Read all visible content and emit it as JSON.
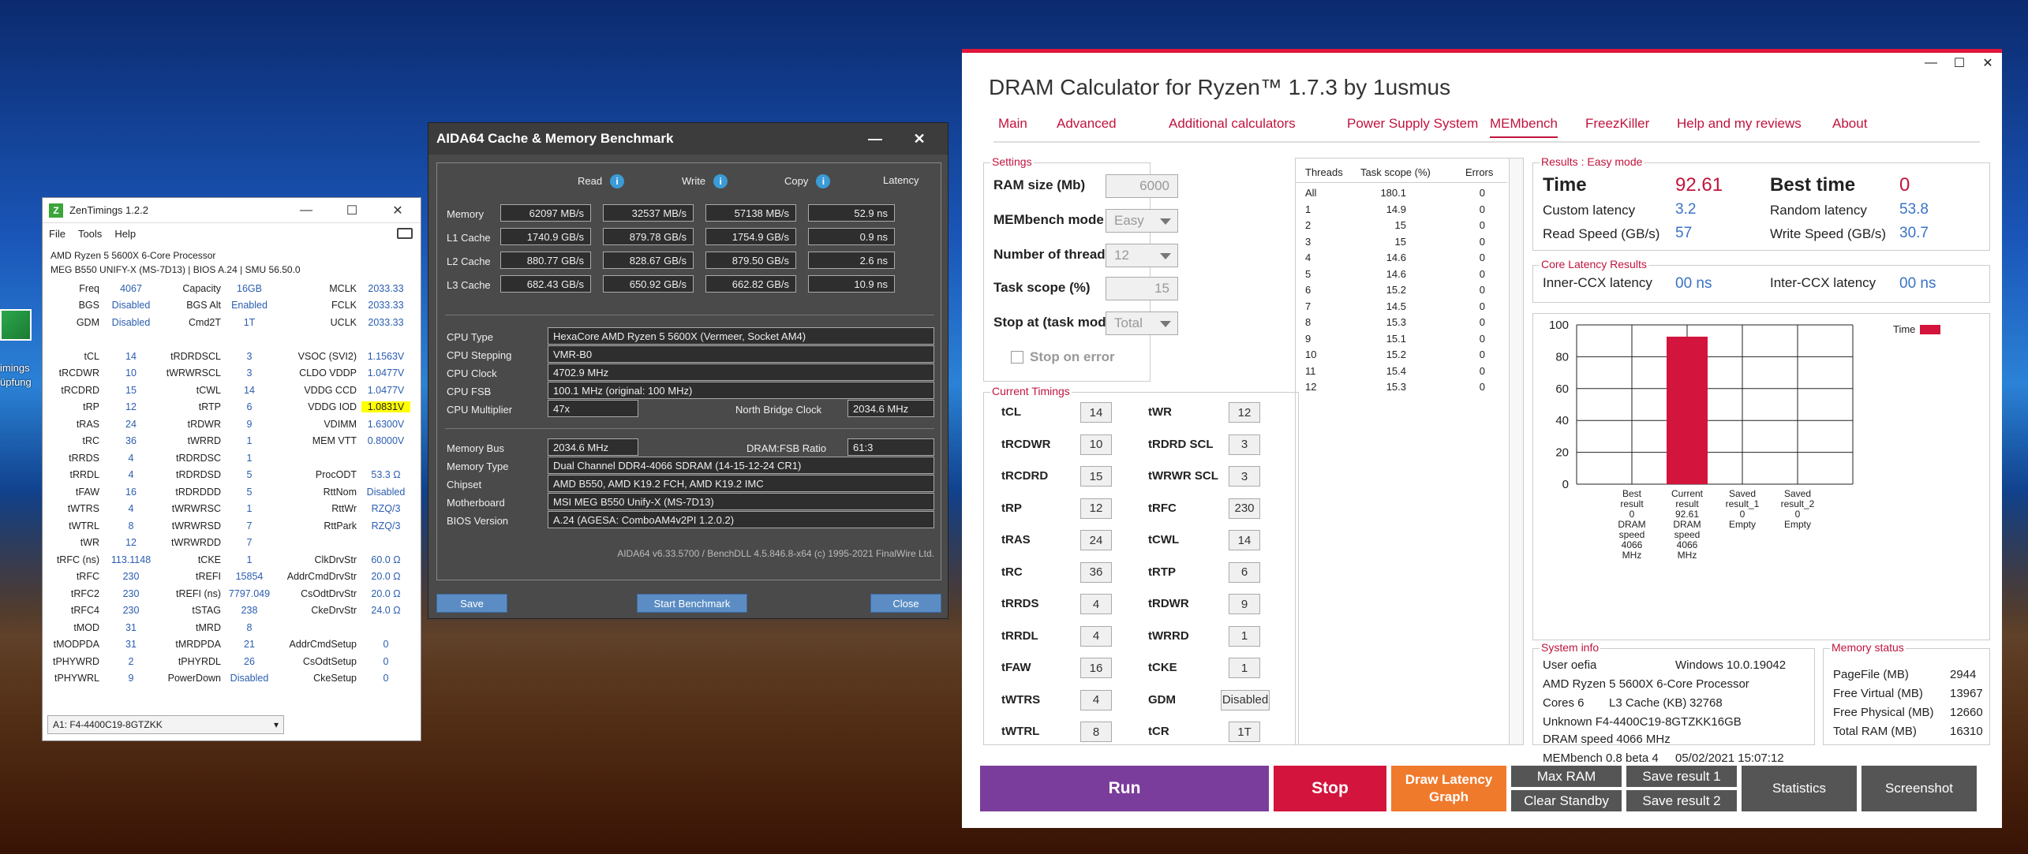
{
  "desktop": {
    "icon_label_1": "imings",
    "icon_label_2": "üpfung"
  },
  "zen": {
    "title": "ZenTimings 1.2.2",
    "menu": [
      "File",
      "Tools",
      "Help"
    ],
    "cpu": "AMD Ryzen 5 5600X 6-Core Processor",
    "board": "MEG B550 UNIFY-X (MS-7D13) | BIOS A.24 | SMU 56.50.0",
    "rows": [
      [
        "Freq",
        "4067",
        "Capacity",
        "16GB",
        "MCLK",
        "2033.33"
      ],
      [
        "BGS",
        "Disabled",
        "BGS Alt",
        "Enabled",
        "FCLK",
        "2033.33"
      ],
      [
        "GDM",
        "Disabled",
        "Cmd2T",
        "1T",
        "UCLK",
        "2033.33"
      ],
      [
        "",
        "",
        "",
        "",
        "",
        ""
      ],
      [
        "tCL",
        "14",
        "tRDRDSCL",
        "3",
        "VSOC (SVI2)",
        "1.1563V"
      ],
      [
        "tRCDWR",
        "10",
        "tWRWRSCL",
        "3",
        "CLDO VDDP",
        "1.0477V"
      ],
      [
        "tRCDRD",
        "15",
        "tCWL",
        "14",
        "VDDG CCD",
        "1.0477V"
      ],
      [
        "tRP",
        "12",
        "tRTP",
        "6",
        "VDDG IOD",
        "1.0831V"
      ],
      [
        "tRAS",
        "24",
        "tRDWR",
        "9",
        "VDIMM",
        "1.6300V"
      ],
      [
        "tRC",
        "36",
        "tWRRD",
        "1",
        "MEM VTT",
        "0.8000V"
      ],
      [
        "tRRDS",
        "4",
        "tRDRDSC",
        "1",
        "",
        ""
      ],
      [
        "tRRDL",
        "4",
        "tRDRDSD",
        "5",
        "ProcODT",
        "53.3 Ω"
      ],
      [
        "tFAW",
        "16",
        "tRDRDDD",
        "5",
        "RttNom",
        "Disabled"
      ],
      [
        "tWTRS",
        "4",
        "tWRWRSC",
        "1",
        "RttWr",
        "RZQ/3"
      ],
      [
        "tWTRL",
        "8",
        "tWRWRSD",
        "7",
        "RttPark",
        "RZQ/3"
      ],
      [
        "tWR",
        "12",
        "tWRWRDD",
        "7",
        "",
        ""
      ],
      [
        "tRFC (ns)",
        "113.1148",
        "tCKE",
        "1",
        "ClkDrvStr",
        "60.0 Ω"
      ],
      [
        "tRFC",
        "230",
        "tREFI",
        "15854",
        "AddrCmdDrvStr",
        "20.0 Ω"
      ],
      [
        "tRFC2",
        "230",
        "tREFI (ns)",
        "7797.049",
        "CsOdtDrvStr",
        "20.0 Ω"
      ],
      [
        "tRFC4",
        "230",
        "tSTAG",
        "238",
        "CkeDrvStr",
        "24.0 Ω"
      ],
      [
        "tMOD",
        "31",
        "tMRD",
        "8",
        "",
        ""
      ],
      [
        "tMODPDA",
        "31",
        "tMRDPDA",
        "21",
        "AddrCmdSetup",
        "0"
      ],
      [
        "tPHYWRD",
        "2",
        "tPHYRDL",
        "26",
        "CsOdtSetup",
        "0"
      ],
      [
        "tPHYWRL",
        "9",
        "PowerDown",
        "Disabled",
        "CkeSetup",
        "0"
      ]
    ],
    "module": "A1: F4-4400C19-8GTZKK"
  },
  "aida": {
    "title": "AIDA64 Cache & Memory Benchmark",
    "headers": [
      "Read",
      "Write",
      "Copy",
      "Latency"
    ],
    "bench": [
      {
        "label": "Memory",
        "read": "62097 MB/s",
        "write": "32537 MB/s",
        "copy": "57138 MB/s",
        "lat": "52.9 ns"
      },
      {
        "label": "L1 Cache",
        "read": "1740.9 GB/s",
        "write": "879.78 GB/s",
        "copy": "1754.9 GB/s",
        "lat": "0.9 ns"
      },
      {
        "label": "L2 Cache",
        "read": "880.77 GB/s",
        "write": "828.67 GB/s",
        "copy": "879.50 GB/s",
        "lat": "2.6 ns"
      },
      {
        "label": "L3 Cache",
        "read": "682.43 GB/s",
        "write": "650.92 GB/s",
        "copy": "662.82 GB/s",
        "lat": "10.9 ns"
      }
    ],
    "cpu_type_l": "CPU Type",
    "cpu_type": "HexaCore AMD Ryzen 5 5600X  (Vermeer, Socket AM4)",
    "cpu_step_l": "CPU Stepping",
    "cpu_step": "VMR-B0",
    "cpu_clock_l": "CPU Clock",
    "cpu_clock": "4702.9 MHz",
    "cpu_fsb_l": "CPU FSB",
    "cpu_fsb": "100.1 MHz  (original: 100 MHz)",
    "cpu_mult_l": "CPU Multiplier",
    "cpu_mult": "47x",
    "nb_l": "North Bridge Clock",
    "nb": "2034.6 MHz",
    "mem_bus_l": "Memory Bus",
    "mem_bus": "2034.6 MHz",
    "ratio_l": "DRAM:FSB Ratio",
    "ratio": "61:3",
    "mem_type_l": "Memory Type",
    "mem_type": "Dual Channel DDR4-4066 SDRAM  (14-15-12-24 CR1)",
    "chipset_l": "Chipset",
    "chipset": "AMD B550, AMD K19.2 FCH, AMD K19.2 IMC",
    "mobo_l": "Motherboard",
    "mobo": "MSI MEG B550 Unify-X (MS-7D13)",
    "bios_l": "BIOS Version",
    "bios": "A.24  (AGESA: ComboAM4v2PI 1.2.0.2)",
    "version": "AIDA64 v6.33.5700 / BenchDLL 4.5.846.8-x64  (c) 1995-2021 FinalWire Ltd.",
    "btn_save": "Save",
    "btn_start": "Start Benchmark",
    "btn_close": "Close"
  },
  "dram": {
    "title": "DRAM Calculator for Ryzen™ 1.7.3 by 1usmus",
    "tabs": [
      "Main",
      "Advanced",
      "Additional calculators",
      "Power Supply System",
      "MEMbench",
      "FreezKiller",
      "Help and my reviews",
      "About"
    ],
    "settings_title": "Settings",
    "ram_size_l": "RAM size (Mb)",
    "ram_size": "6000",
    "mode_l": "MEMbench mode",
    "mode": "Easy",
    "threads_l": "Number of threads",
    "threads": "12",
    "scope_l": "Task scope (%)",
    "scope": "15",
    "stop_l": "Stop at (task mode)",
    "stop": "Total",
    "stop_err": "Stop on error",
    "timings_title": "Current Timings",
    "timings_left": [
      [
        "tCL",
        "14"
      ],
      [
        "tRCDWR",
        "10"
      ],
      [
        "tRCDRD",
        "15"
      ],
      [
        "tRP",
        "12"
      ],
      [
        "tRAS",
        "24"
      ],
      [
        "tRC",
        "36"
      ],
      [
        "tRRDS",
        "4"
      ],
      [
        "tRRDL",
        "4"
      ],
      [
        "tFAW",
        "16"
      ],
      [
        "tWTRS",
        "4"
      ],
      [
        "tWTRL",
        "8"
      ]
    ],
    "timings_right": [
      [
        "tWR",
        "12"
      ],
      [
        "tRDRD SCL",
        "3"
      ],
      [
        "tWRWR SCL",
        "3"
      ],
      [
        "tRFC",
        "230"
      ],
      [
        "tCWL",
        "14"
      ],
      [
        "tRTP",
        "6"
      ],
      [
        "tRDWR",
        "9"
      ],
      [
        "tWRRD",
        "1"
      ],
      [
        "tCKE",
        "1"
      ],
      [
        "GDM",
        "Disabled"
      ],
      [
        "tCR",
        "1T"
      ]
    ],
    "thr_headers": [
      "Threads",
      "Task scope (%)",
      "Errors"
    ],
    "thr_rows": [
      [
        "All",
        "180.1",
        "0"
      ],
      [
        "1",
        "14.9",
        "0"
      ],
      [
        "2",
        "15",
        "0"
      ],
      [
        "3",
        "15",
        "0"
      ],
      [
        "4",
        "14.6",
        "0"
      ],
      [
        "5",
        "14.6",
        "0"
      ],
      [
        "6",
        "15.2",
        "0"
      ],
      [
        "7",
        "14.5",
        "0"
      ],
      [
        "8",
        "15.3",
        "0"
      ],
      [
        "9",
        "15.1",
        "0"
      ],
      [
        "10",
        "15.2",
        "0"
      ],
      [
        "11",
        "15.4",
        "0"
      ],
      [
        "12",
        "15.3",
        "0"
      ]
    ],
    "results_title": "Results : Easy mode",
    "time_l": "Time",
    "time": "92.61",
    "best_l": "Best time",
    "best": "0",
    "custom_l": "Custom latency",
    "custom": "3.2",
    "random_l": "Random latency",
    "random": "53.8",
    "read_l": "Read Speed (GB/s)",
    "read": "57",
    "write_l": "Write Speed (GB/s)",
    "write": "30.7",
    "core_title": "Core Latency Results",
    "inner_l": "Inner-CCX latency",
    "inner": "00 ns",
    "inter_l": "Inter-CCX latency",
    "inter": "00 ns",
    "sys_title": "System info",
    "user": "User oefia",
    "os": "Windows 10.0.19042",
    "cpu": "AMD Ryzen 5 5600X 6-Core Processor",
    "cores": "Cores 6",
    "l3": "L3 Cache (KB)",
    "l3v": "32768",
    "module": "Unknown F4-4400C19-8GTZKK16GB",
    "dram_speed": "DRAM speed 4066 MHz",
    "ver": "MEMbench 0.8 beta 4",
    "date": "05/02/2021 15:07:12",
    "mem_title": "Memory status",
    "pf_l": "PageFile (MB)",
    "pf": "2944",
    "fv_l": "Free Virtual (MB)",
    "fv": "13967",
    "fp_l": "Free Physical (MB)",
    "fp": "12660",
    "tr_l": "Total RAM (MB)",
    "tr": "16310",
    "btn_run": "Run",
    "btn_stop": "Stop",
    "btn_draw": "Draw Latency Graph",
    "btn_maxram": "Max RAM",
    "btn_clear": "Clear Standby",
    "btn_save1": "Save result 1",
    "btn_save2": "Save result 2",
    "btn_stats": "Statistics",
    "btn_shot": "Screenshot",
    "colors": {
      "accent": "#c0143c",
      "run": "#7b3d9b",
      "stop": "#d3143c",
      "draw": "#f07a2c",
      "grey": "#555555"
    }
  },
  "chart_data": {
    "type": "bar",
    "legend": [
      "Time"
    ],
    "legend_position": "top-right",
    "ylim": [
      0,
      100
    ],
    "yticks": [
      "0",
      "20",
      "40",
      "60",
      "80",
      "100"
    ],
    "categories": [
      [
        "Best",
        "result",
        "0",
        "DRAM",
        "speed",
        "4066",
        "MHz"
      ],
      [
        "Current",
        "result",
        "92.61",
        "DRAM",
        "speed",
        "4066",
        "MHz"
      ],
      [
        "Saved",
        "result_1",
        "0",
        "Empty"
      ],
      [
        "Saved",
        "result_2",
        "0",
        "Empty"
      ]
    ],
    "values": [
      0,
      92.61,
      0,
      0
    ],
    "color": "#d3143c"
  }
}
